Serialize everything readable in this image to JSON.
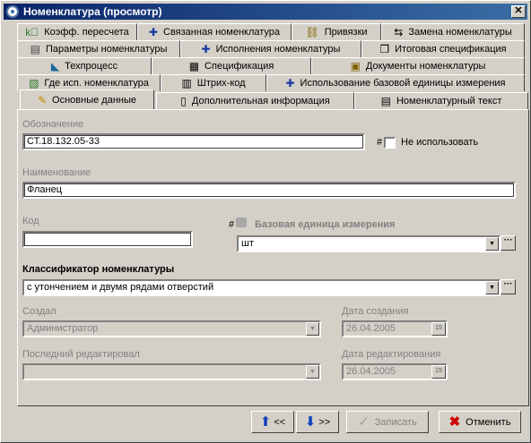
{
  "window": {
    "title": "Номенклатура (просмотр)",
    "close_glyph": "✕"
  },
  "tabs": {
    "row1": [
      {
        "label": "Коэфф. пересчета",
        "icon": "ratio-icon"
      },
      {
        "label": "Связанная номенклатура",
        "icon": "add-link-icon"
      },
      {
        "label": "Привязки",
        "icon": "binding-icon"
      },
      {
        "label": "Замена номенклатуры",
        "icon": "swap-icon"
      }
    ],
    "row2": [
      {
        "label": "Параметры номенклатуры",
        "icon": "parameters-icon"
      },
      {
        "label": "Исполнения номенклатуры",
        "icon": "add-variant-icon"
      },
      {
        "label": "Итоговая спецификация",
        "icon": "summary-spec-icon"
      }
    ],
    "row3": [
      {
        "label": "Техпроцесс",
        "icon": "tech-process-icon"
      },
      {
        "label": "Спецификация",
        "icon": "spec-table-icon"
      },
      {
        "label": "Документы номенклатуры",
        "icon": "documents-icon"
      }
    ],
    "row4": [
      {
        "label": "Где исп. номенклатура",
        "icon": "where-used-icon"
      },
      {
        "label": "Штрих-код",
        "icon": "barcode-icon"
      },
      {
        "label": "Использование базовой единицы измерения",
        "icon": "add-unit-icon"
      }
    ],
    "row5": [
      {
        "label": "Основные данные",
        "icon": "main-data-icon",
        "active": true
      },
      {
        "label": "Дополнительная информация",
        "icon": "info-doc-icon"
      },
      {
        "label": "Номенклатурный текст",
        "icon": "text-doc-icon"
      }
    ]
  },
  "form": {
    "designation_label": "Обозначение",
    "designation_value": "СТ.18.132.05-33",
    "hash": "#",
    "not_used_label": "Не использовать",
    "name_label": "Наименование",
    "name_value": "Фланец",
    "code_label": "Код",
    "code_value": "",
    "base_unit_label": "Базовая единица измерения",
    "base_unit_value": "шт",
    "classifier_label": "Классификатор номенклатуры",
    "classifier_value": "с утончением и двумя рядами отверстий",
    "created_by_label": "Создал",
    "created_by_value": "Администратор",
    "created_date_label": "Дата создания",
    "created_date_value": "26.04.2005",
    "edited_by_label": "Последний редактировал",
    "edited_by_value": "",
    "edited_date_label": "Дата редактирования",
    "edited_date_value": "26.04.2005",
    "dots": "···",
    "calendar_glyph": "15"
  },
  "buttons": {
    "prev_label": "<<",
    "next_label": ">>",
    "save_label": "Записать",
    "cancel_label": "Отменить"
  },
  "colors": {
    "title_start": "#0a246a",
    "title_end": "#3a6ea5",
    "face": "#d4d0c8",
    "cancel_x": "#cc0000",
    "arrow_blue": "#1040c0"
  }
}
